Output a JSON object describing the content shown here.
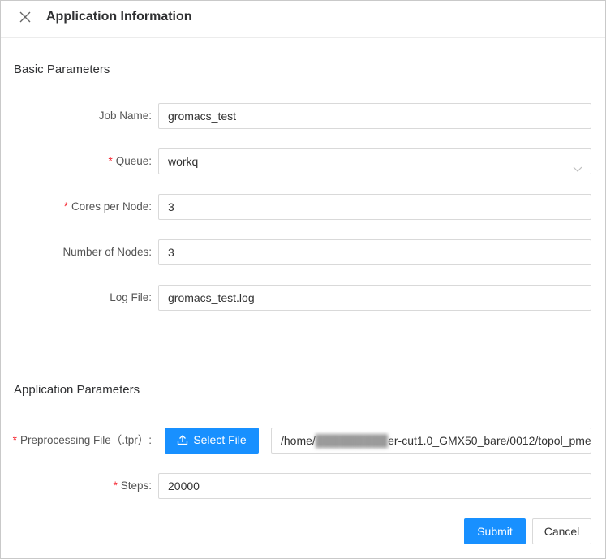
{
  "header": {
    "title": "Application Information",
    "close_icon": "close-icon"
  },
  "basic": {
    "section_title": "Basic Parameters",
    "job_name": {
      "label": "Job Name:",
      "value": "gromacs_test"
    },
    "queue": {
      "required": "*",
      "label": "Queue:",
      "value": "workq",
      "icon": "chevron-down-icon"
    },
    "cores": {
      "required": "*",
      "label": "Cores per Node:",
      "value": "3"
    },
    "nodes": {
      "label": "Number of Nodes:",
      "value": "3"
    },
    "log_file": {
      "label": "Log File:",
      "value": "gromacs_test.log"
    }
  },
  "app": {
    "section_title": "Application Parameters",
    "preprocessing": {
      "required": "*",
      "label": "Preprocessing File（.tpr）:",
      "select_label": "Select File",
      "upload_icon": "upload-icon",
      "path_prefix": "/home/",
      "path_hidden": "█████████",
      "path_suffix": "er-cut1.0_GMX50_bare/0012/topol_pme"
    },
    "steps": {
      "required": "*",
      "label": "Steps:",
      "value": "20000"
    }
  },
  "footer": {
    "submit_label": "Submit",
    "cancel_label": "Cancel"
  },
  "colors": {
    "primary": "#1890ff",
    "required": "#f5222d",
    "border": "#d9d9d9"
  }
}
